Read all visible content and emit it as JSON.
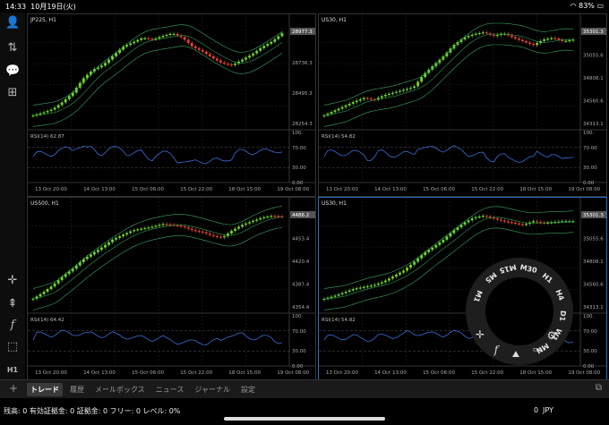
{
  "status_bar": {
    "time": "14:33",
    "date": "10月19日(火)",
    "battery": "83%"
  },
  "sidebar": {
    "top_icons": [
      "account-icon",
      "trade-icon",
      "chat-icon",
      "add-document-icon"
    ],
    "bottom_icons": [
      "crosshair-icon",
      "candles-icon",
      "indicator-icon",
      "objects-icon"
    ],
    "timeframe_label": "H1"
  },
  "charts": [
    {
      "id": "jp225",
      "title": "JP225, H1",
      "rsi_label": "RSI(14) 62.87",
      "price_ticks": [
        "28977.3",
        "28736.3",
        "28495.3",
        "28254.3"
      ],
      "current_price": "28977.3",
      "rsi_ticks": [
        "100.",
        "70.00",
        "30.00",
        "0.00"
      ],
      "time_ticks": [
        "13 Oct 20:00",
        "14 Oct 13:00",
        "15 Oct 06:00",
        "15 Oct 22:00",
        "18 Oct 15:00",
        "19 Oct 08:00"
      ]
    },
    {
      "id": "us30_a",
      "title": "US30, H1",
      "rsi_label": "RSI(14) 54.82",
      "price_ticks": [
        "35301.3",
        "35055.6",
        "34808.1",
        "34560.6",
        "34313.1"
      ],
      "current_price": "35301.3",
      "rsi_ticks": [
        "100.",
        "70.00",
        "30.00",
        "0.00"
      ],
      "time_ticks": [
        "13 Oct 20:00",
        "14 Oct 13:00",
        "15 Oct 06:00",
        "15 Oct 22:00",
        "18 Oct 15:00",
        "19 Oct 08:00"
      ]
    },
    {
      "id": "us500",
      "title": "US500, H1",
      "rsi_label": "RSI(14) 64.42",
      "price_ticks": [
        "4486.2",
        "4453.4",
        "4420.4",
        "4387.4",
        "4354.4"
      ],
      "current_price": "4486.2",
      "rsi_ticks": [
        "100.",
        "70.00",
        "30.00",
        "0.00"
      ],
      "time_ticks": [
        "13 Oct 20:00",
        "14 Oct 13:00",
        "15 Oct 06:00",
        "15 Oct 22:00",
        "18 Oct 15:00",
        "19 Oct 08:00"
      ]
    },
    {
      "id": "us30_b",
      "title": "US30, H1",
      "rsi_label": "RSI(14) 54.82",
      "price_ticks": [
        "35301.3",
        "35055.6",
        "34808.1",
        "34560.6",
        "34313.1"
      ],
      "current_price": "35301.3",
      "rsi_ticks": [
        "100.",
        "70.00",
        "30.00",
        "0.00"
      ],
      "time_ticks": [
        "13 Oct 20:00",
        "14 Oct 13:00",
        "15 Oct 06:00",
        "15 Oct 22:00",
        "18 Oct 15:00",
        "19 Oct 08:00"
      ]
    }
  ],
  "timeframe_wheel": {
    "timeframes": [
      "M1",
      "M5",
      "M15",
      "M30",
      "H1",
      "H4",
      "D1",
      "W1",
      "MN"
    ]
  },
  "tabs": [
    "トレード",
    "履歴",
    "メールボックス",
    "ニュース",
    "ジャーナル",
    "設定"
  ],
  "footer": {
    "account_summary": "残高: 0 有効証拠金: 0 証拠金: 0 フリー: 0 レベル: 0%",
    "balance_value": "0",
    "currency": "JPY"
  },
  "colors": {
    "bull": "#6fd62a",
    "bear": "#e8402f",
    "ma": "#2e9a56",
    "band": "#3aa860",
    "rsi": "#3a6ed8",
    "grid": "#262626",
    "active_border": "#2a6fbf"
  }
}
